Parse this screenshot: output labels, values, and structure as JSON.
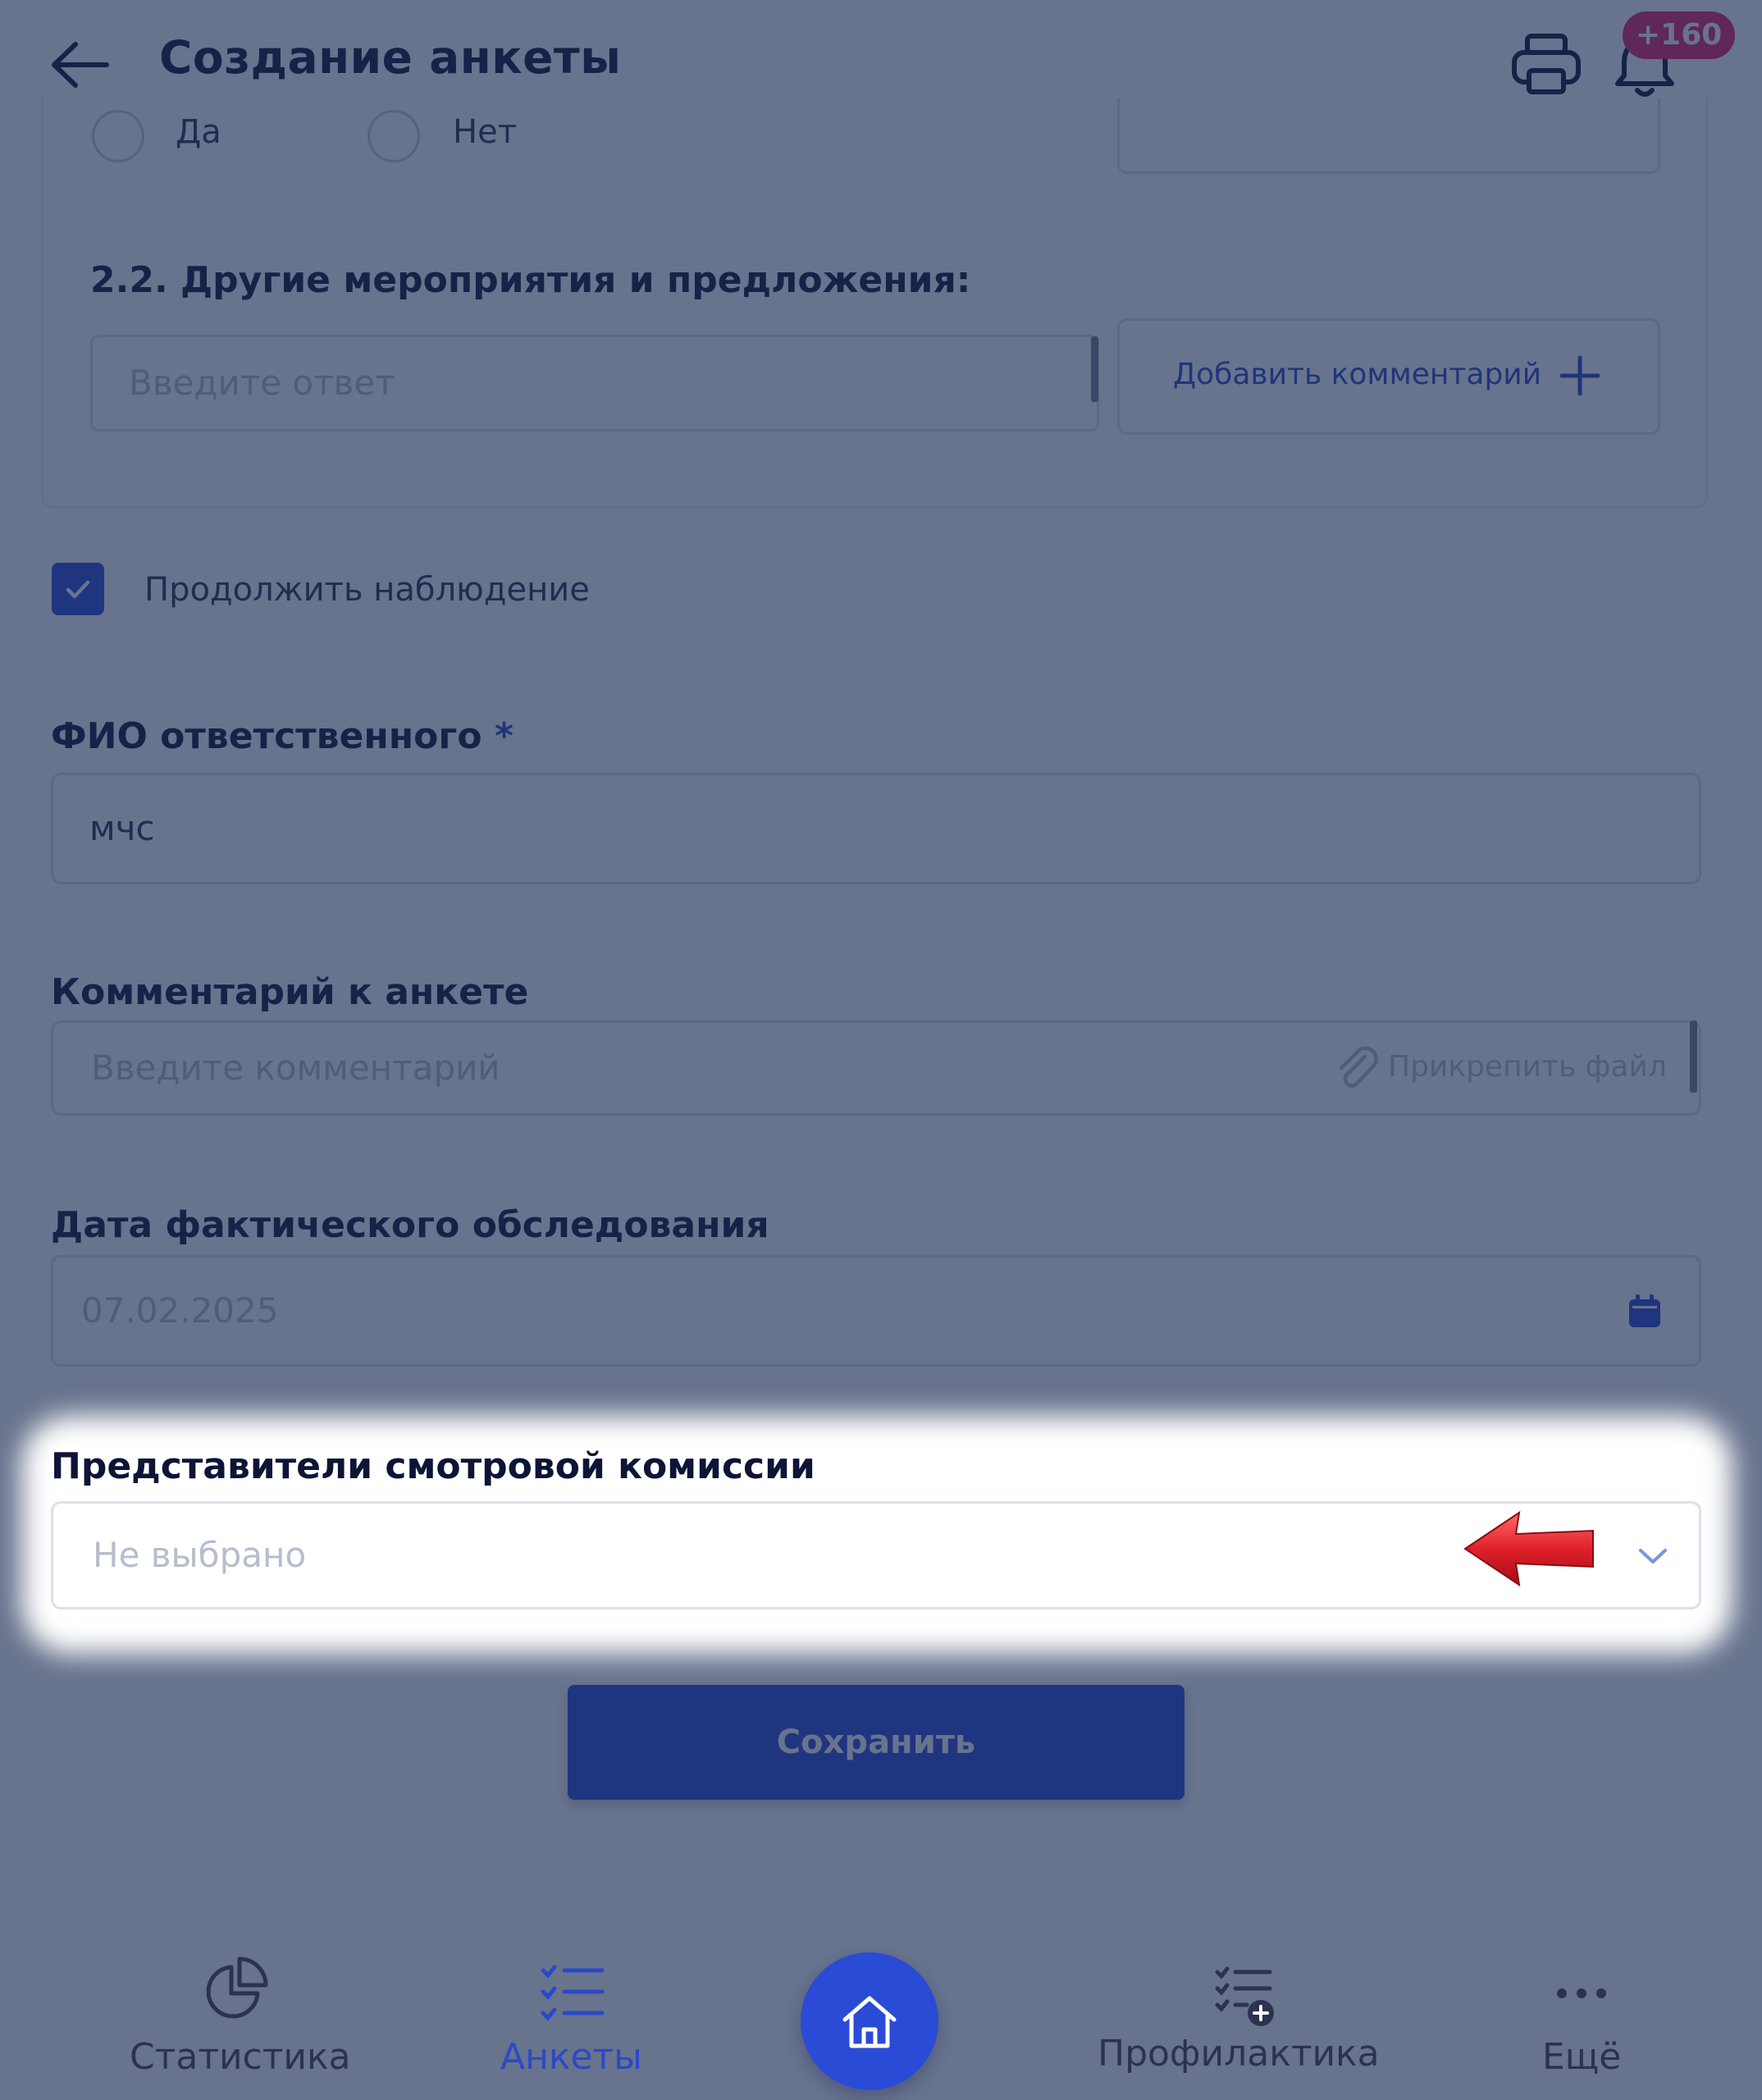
{
  "header": {
    "title": "Создание анкеты",
    "notification_count": "+160"
  },
  "radio_options": [
    "Да",
    "Нет"
  ],
  "question": {
    "title": "2.2. Другие мероприятия и предложения:",
    "answer_placeholder": "Введите ответ",
    "add_comment_label": "Добавить комментарий"
  },
  "continue_observation": {
    "label": "Продолжить наблюдение",
    "checked": true
  },
  "form": {
    "responsible": {
      "label": "ФИО ответственного",
      "required_mark": "*",
      "value": "мчс"
    },
    "comment": {
      "label": "Комментарий к анкете",
      "placeholder": "Введите комментарий",
      "attach_label": "Прикрепить файл"
    },
    "survey_date": {
      "label": "Дата фактического обследования",
      "value": "07.02.2025"
    },
    "commission": {
      "label": "Представители смотровой комиссии",
      "value": "Не выбрано"
    },
    "save_label": "Сохранить"
  },
  "bottom_nav": {
    "items": [
      {
        "label": "Статистика",
        "icon": "pie-chart-icon",
        "active": false
      },
      {
        "label": "Анкеты",
        "icon": "checklist-icon",
        "active": true
      },
      {
        "label": "Профилактика",
        "icon": "checklist-add-icon",
        "active": false
      },
      {
        "label": "Ещё",
        "icon": "more-dots-icon",
        "active": false
      }
    ]
  },
  "colors": {
    "accent": "#2a4bd6",
    "badge": "#e4206a",
    "overlay": "#1a2a52",
    "pointer_arrow": "#e0202a"
  }
}
